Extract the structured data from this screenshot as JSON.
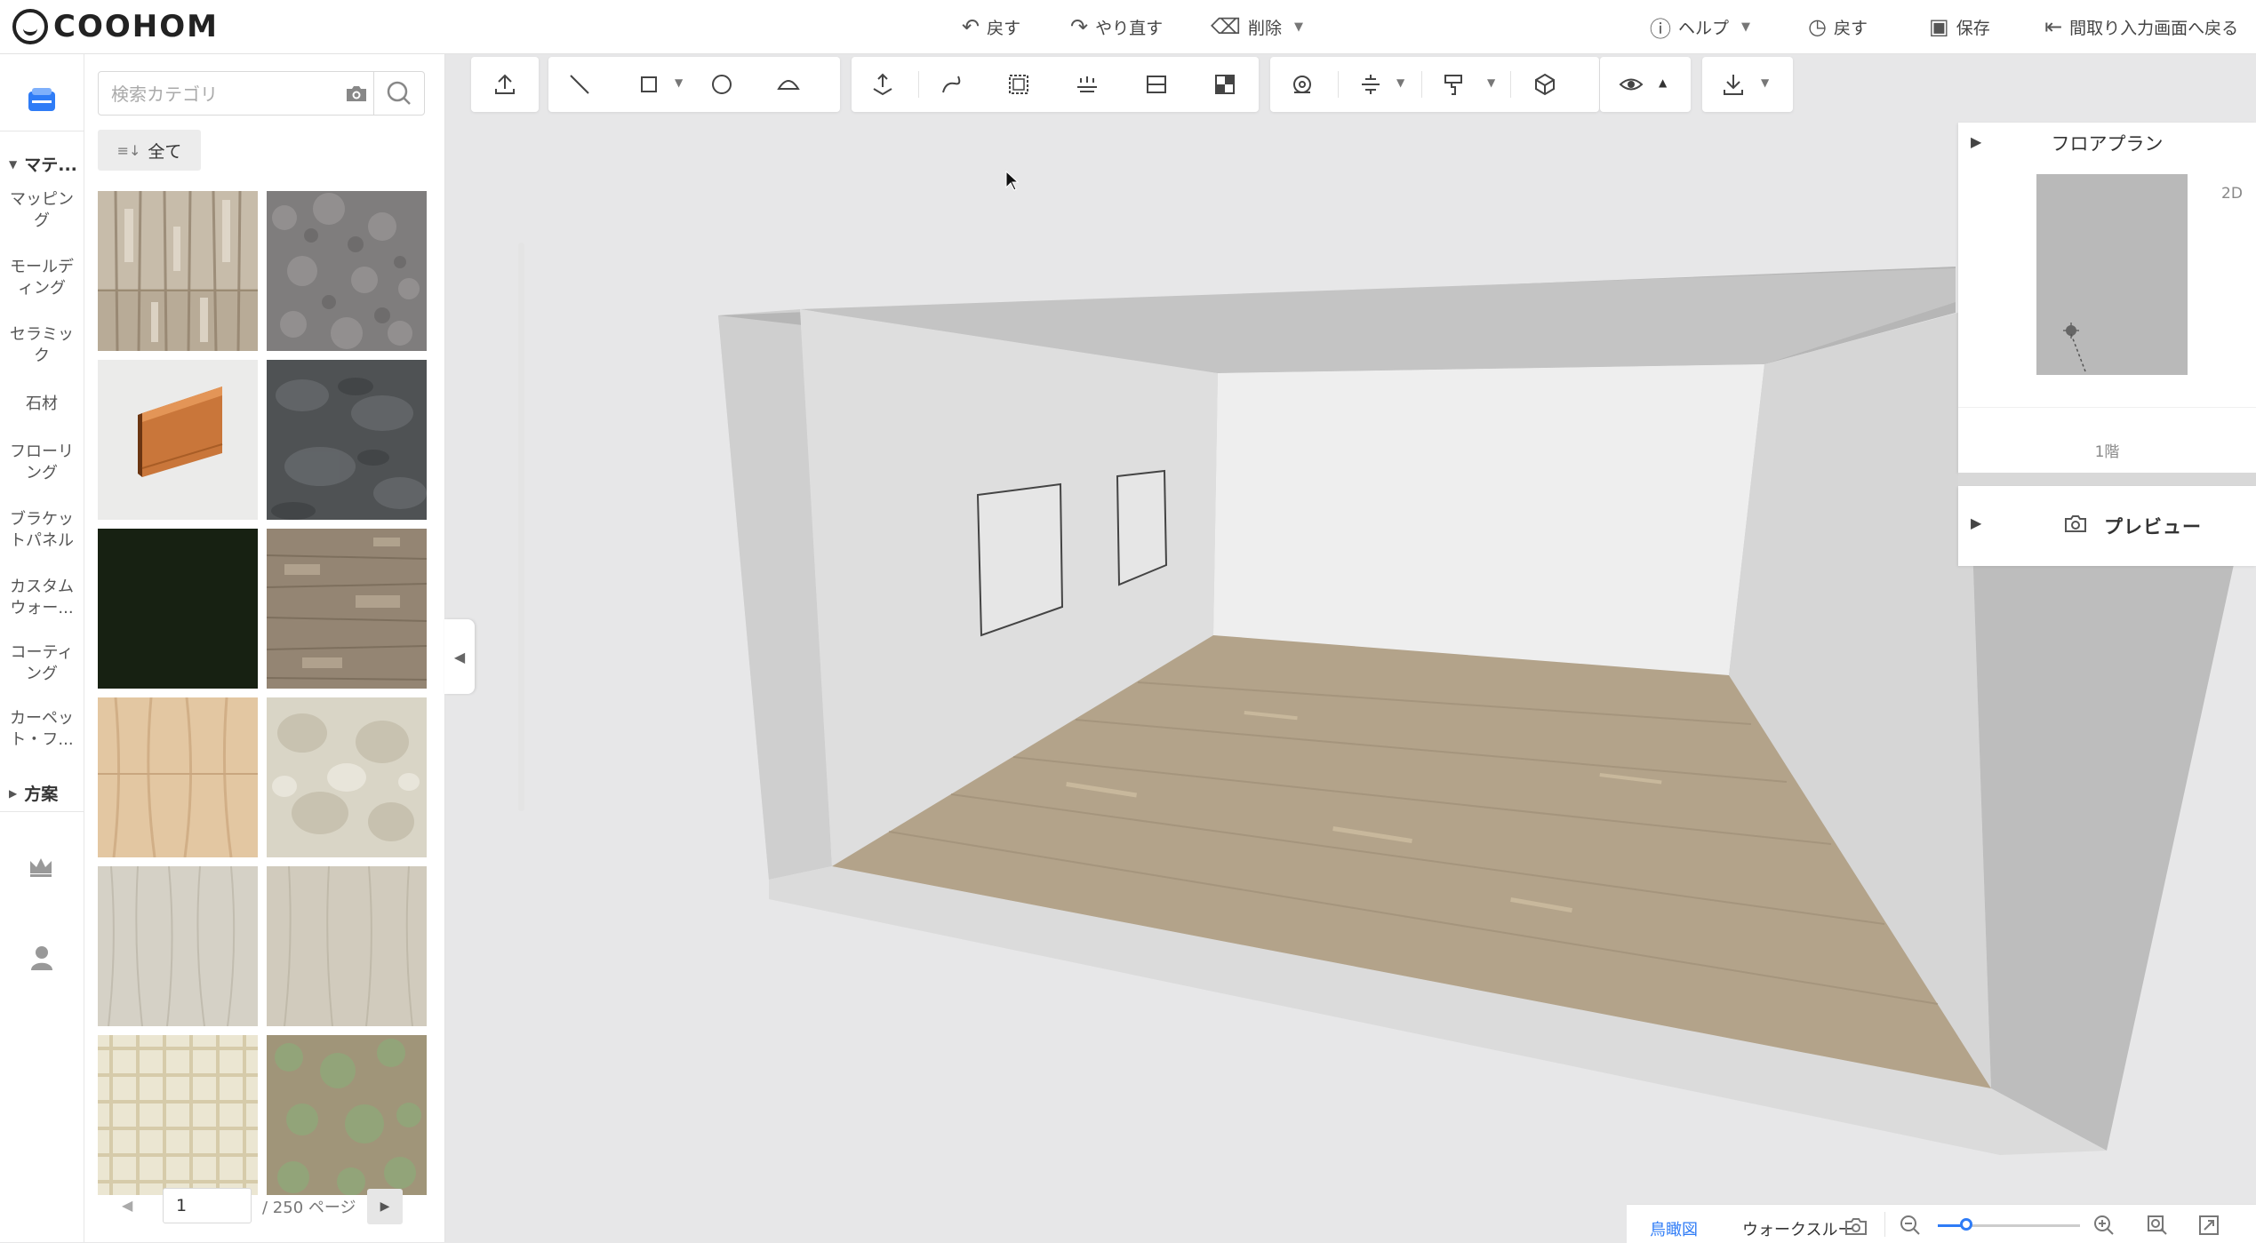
{
  "app": {
    "logo_text": "COOHOM",
    "accent": "#2f7cf6"
  },
  "header": {
    "undo_label": "戻す",
    "redo_label": "やり直す",
    "delete_label": "削除",
    "help_label": "ヘルプ",
    "history_label": "戻す",
    "save_label": "保存",
    "back_to_floorplan_label": "間取り入力画面へ戻る"
  },
  "rail": {
    "section_materials": "マテ...",
    "items": [
      "マッピング",
      "モールディング",
      "セラミック",
      "石材",
      "フローリング",
      "ブラケットパネル",
      "カスタムウォー...",
      "コーティング",
      "カーペット・フ..."
    ],
    "section_plans": "方案"
  },
  "panel": {
    "search_placeholder": "検索カテゴリ",
    "filter_label": "全て",
    "tiles": [
      {
        "name": "tile-weathered-wood"
      },
      {
        "name": "tile-gray-carpet"
      },
      {
        "name": "tile-wood-baseboard"
      },
      {
        "name": "tile-dark-stone"
      },
      {
        "name": "tile-black-green"
      },
      {
        "name": "tile-brown-wood"
      },
      {
        "name": "tile-light-oak"
      },
      {
        "name": "tile-cream-marble"
      },
      {
        "name": "tile-pale-wood-1"
      },
      {
        "name": "tile-pale-wood-2"
      },
      {
        "name": "tile-beige-check"
      },
      {
        "name": "tile-green-speckle"
      }
    ],
    "pager": {
      "current": "1",
      "total_label": "/ 250 ページ"
    }
  },
  "floorplan": {
    "title": "フロアプラン",
    "mode_label": "2D",
    "level_label": "1階"
  },
  "preview": {
    "title": "プレビュー"
  },
  "bottom": {
    "view_birdseye": "鳥瞰図",
    "view_walkthrough": "ウォークスルー",
    "zoom_fraction": 0.2
  }
}
